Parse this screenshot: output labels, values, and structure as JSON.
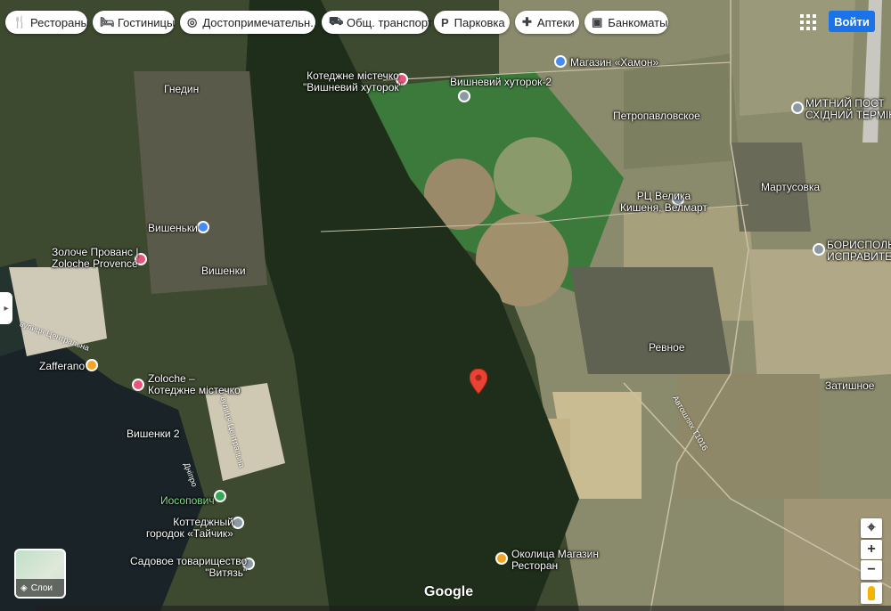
{
  "chips": [
    {
      "icon": "fork-knife-icon",
      "glyph": "🍴",
      "label": "Рестораны"
    },
    {
      "icon": "bed-icon",
      "glyph": "🛏",
      "label": "Гостиницы"
    },
    {
      "icon": "camera-icon",
      "glyph": "◎",
      "label": "Достопримечательн..."
    },
    {
      "icon": "bus-icon",
      "glyph": "⛟",
      "label": "Общ. транспорт"
    },
    {
      "icon": "parking-icon",
      "glyph": "P",
      "label": "Парковка"
    },
    {
      "icon": "pharmacy-icon",
      "glyph": "✚",
      "label": "Аптеки"
    },
    {
      "icon": "atm-icon",
      "glyph": "▣",
      "label": "Банкоматы"
    }
  ],
  "header": {
    "signin_label": "Войти",
    "apps_icon": "apps-grid-icon"
  },
  "places": {
    "gnedin": "Гнедин",
    "vishnevyi_khutorok": "Котеджне містечко\n\"Вишневий хуторок\"",
    "vishnevyi_khutorok_2": "Вишневий хуторок-2",
    "khamon": "Магазин «Хамон»",
    "petropavlovskoe": "Петропавловское",
    "mytnyi_post": "МИТНИЙ ПОСТ\nСХІДНИЙ ТЕРМІНА",
    "rts": "РЦ Велика\nКишеня, Велмарт",
    "martusovka": "Мартусовка",
    "borispol": "БОРИСПОЛЬС\nИСПРАВИТЕЛ",
    "vishenki_1": "Вишеньки",
    "vishenki_2": "Вишенки",
    "zoloche_provans": "Золоче Прованс |\nZoloche Provence",
    "zafferano": "Zafferano",
    "zoloche_kotedzh": "Zoloche –\nКотеджне містечко",
    "vishenki_2b": "Вишенки 2",
    "revnoe": "Ревное",
    "zatishnoe": "Затишное",
    "iosopovich": "Иосопович",
    "taychik": "Коттеджный\nгородок «Тайчик»",
    "vityaz": "Садовое товарищество\n\"Витязь\"",
    "okolitsa": "Околица Магазин\nРесторан",
    "road_1": "вулиця Центральна",
    "road_2": "Автошлях Т1016",
    "road_3": "вулиця Центральна",
    "road_4": "Дніпро"
  },
  "controls": {
    "zoom_in": "+",
    "zoom_out": "−",
    "layers_label": "Слои",
    "google": "Google",
    "collapse": "▸"
  },
  "colors": {
    "chip_bg": "#ffffff",
    "signin": "#1a73e8",
    "pin_red": "#ea4335",
    "pin_blue": "#4a89f3",
    "pin_pink": "#e8547c",
    "pin_orange": "#f4a424",
    "pin_green": "#34a853",
    "pin_grey": "#8c9aa6"
  }
}
